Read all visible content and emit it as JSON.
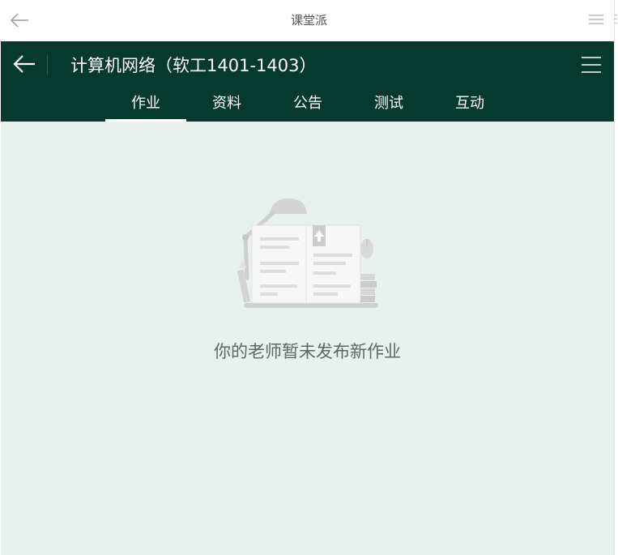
{
  "window": {
    "title": "课堂派"
  },
  "header": {
    "course_title": "计算机网络（软工1401-1403）"
  },
  "tabs": [
    {
      "label": "作业",
      "active": true
    },
    {
      "label": "资料",
      "active": false
    },
    {
      "label": "公告",
      "active": false
    },
    {
      "label": "测试",
      "active": false
    },
    {
      "label": "互动",
      "active": false
    }
  ],
  "empty_state": {
    "message": "你的老师暂未发布新作业",
    "illustration": "book-lamp-illustration"
  },
  "colors": {
    "header_bg": "#073a2e",
    "content_bg": "#e8f1ee",
    "tab_text": "#ffffff",
    "empty_text": "#5f6664"
  },
  "icons": {
    "window_back": "arrow-left-icon",
    "window_menu": "hamburger-menu-icon",
    "header_back": "arrow-left-icon",
    "header_menu": "hamburger-menu-icon"
  }
}
